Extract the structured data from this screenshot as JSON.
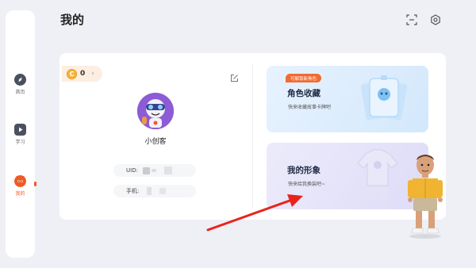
{
  "page": {
    "title": "我的"
  },
  "sidebar": {
    "items": [
      {
        "label": "首页",
        "icon": "compass-icon",
        "active": false
      },
      {
        "label": "学习",
        "icon": "play-icon",
        "active": false
      },
      {
        "label": "我的",
        "icon": "mascot-icon",
        "active": true
      }
    ]
  },
  "header": {
    "icons": [
      "scan-icon",
      "settings-icon"
    ]
  },
  "profile": {
    "coins": "0",
    "coin_symbol": "C",
    "arrow": "›",
    "username": "小创客",
    "uid_label": "UID:",
    "phone_label": "手机:"
  },
  "cards": {
    "collect": {
      "tag": "可解锁新角色",
      "title": "角色收藏",
      "subtitle": "快来收藏故事卡牌吧"
    },
    "image": {
      "title": "我的形象",
      "subtitle": "快来给我换装吧~"
    }
  },
  "colors": {
    "accent": "#ef5b25",
    "arrow": "#e8231c",
    "coin": "#f5b53d"
  }
}
